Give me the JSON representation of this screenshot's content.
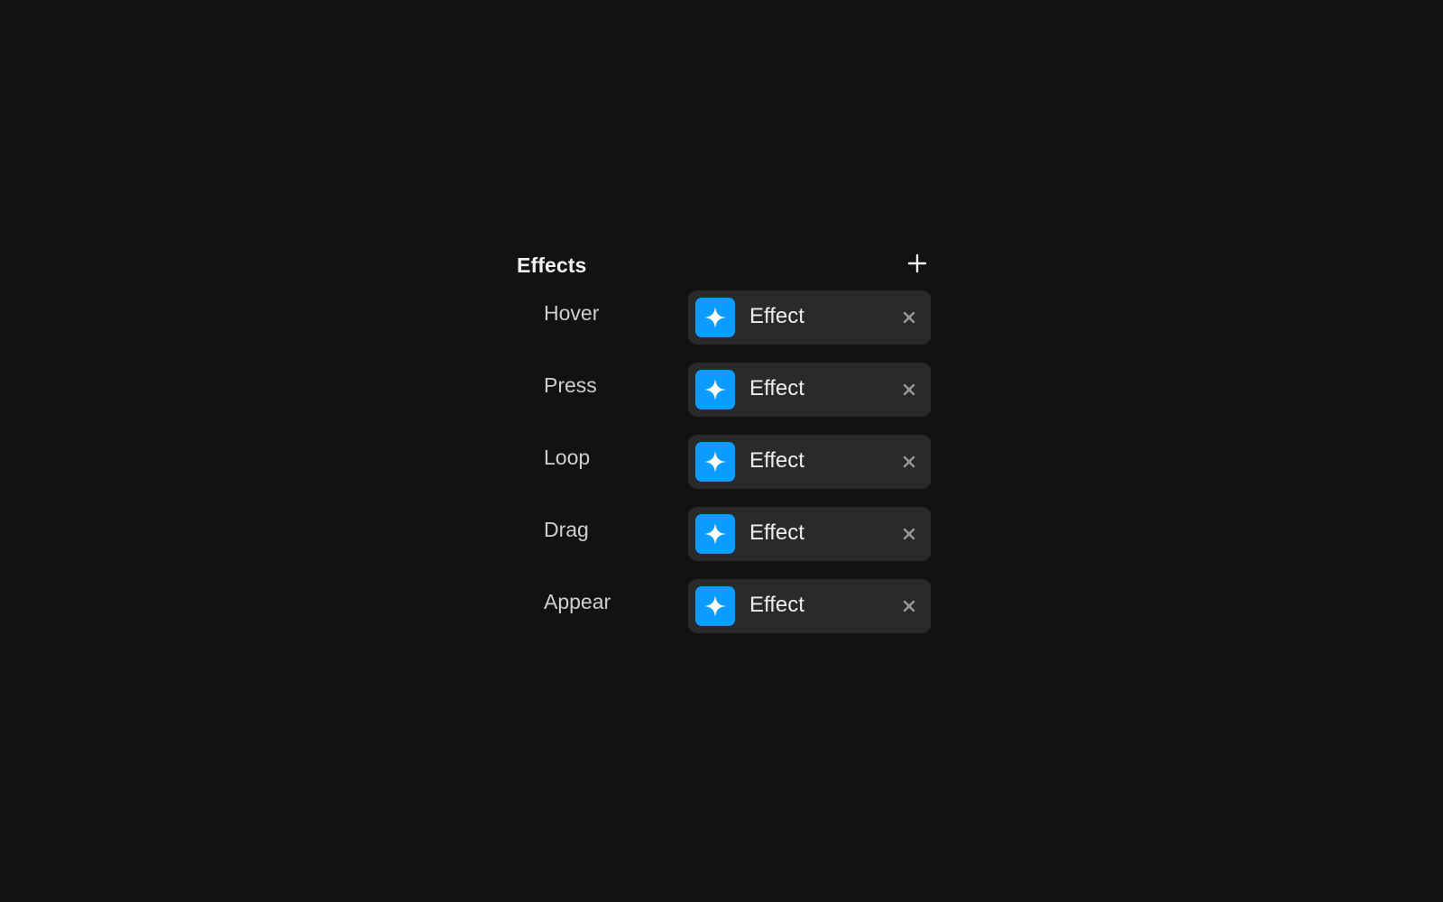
{
  "colors": {
    "background": "#121212",
    "pill_background": "#2a2a2a",
    "accent": "#0a9cff",
    "remove_icon": "#9a9a9a"
  },
  "panel": {
    "title": "Effects",
    "add_icon": "plus-icon",
    "rows": [
      {
        "label": "Hover",
        "effect": "Effect",
        "icon": "sparkle-icon",
        "remove_icon": "close-icon"
      },
      {
        "label": "Press",
        "effect": "Effect",
        "icon": "sparkle-icon",
        "remove_icon": "close-icon"
      },
      {
        "label": "Loop",
        "effect": "Effect",
        "icon": "sparkle-icon",
        "remove_icon": "close-icon"
      },
      {
        "label": "Drag",
        "effect": "Effect",
        "icon": "sparkle-icon",
        "remove_icon": "close-icon"
      },
      {
        "label": "Appear",
        "effect": "Effect",
        "icon": "sparkle-icon",
        "remove_icon": "close-icon"
      }
    ]
  }
}
